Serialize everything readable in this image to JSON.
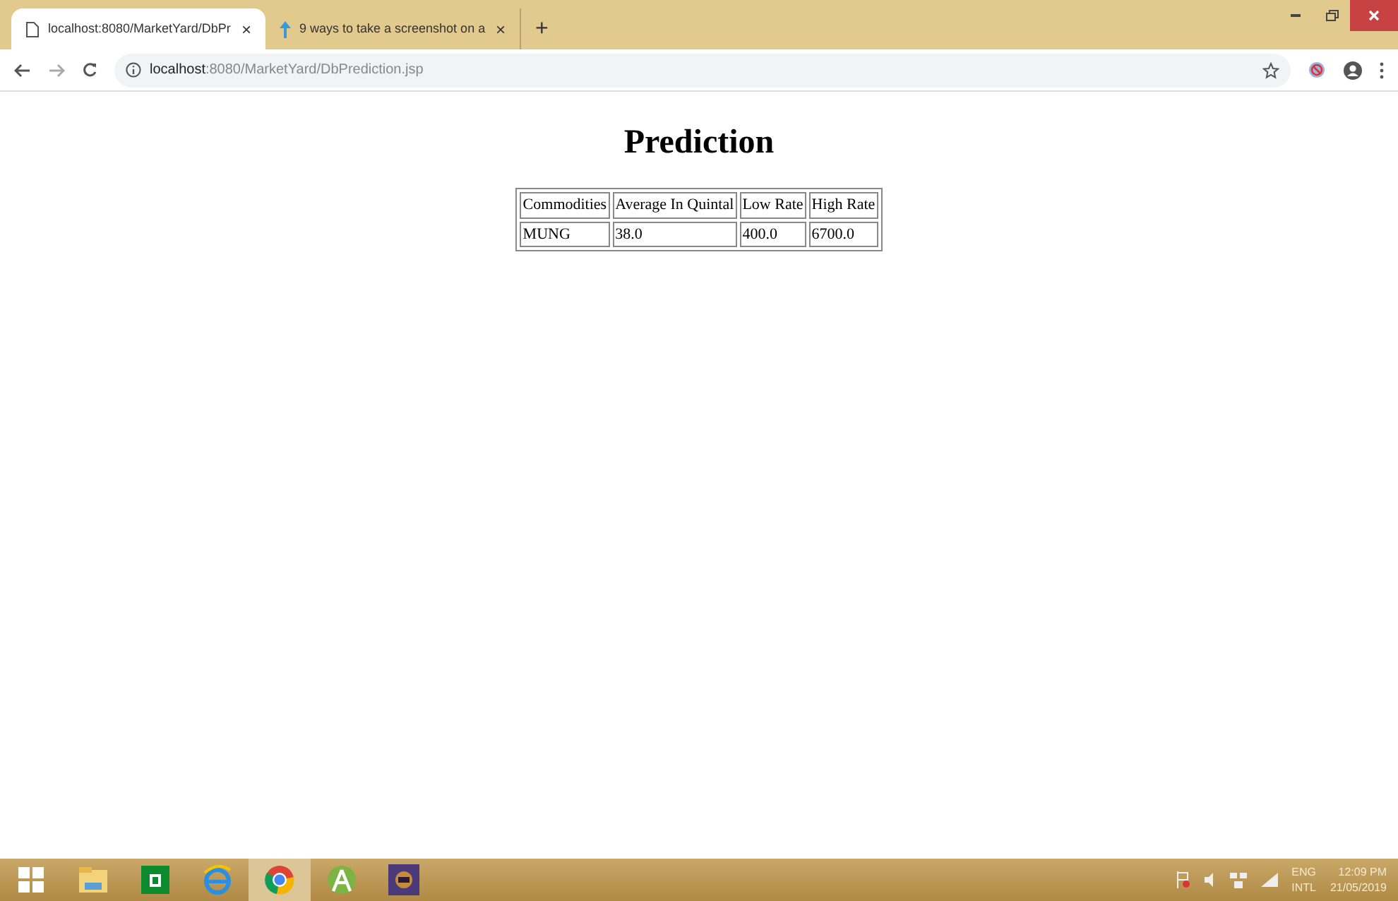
{
  "tabs": [
    {
      "title": "localhost:8080/MarketYard/DbPr",
      "selected": true,
      "close": "×"
    },
    {
      "title": "9 ways to take a screenshot on a",
      "selected": false,
      "close": "×"
    }
  ],
  "new_tab": "+",
  "address": {
    "host": "localhost",
    "path": ":8080/MarketYard/DbPrediction.jsp"
  },
  "page": {
    "heading": "Prediction",
    "table": {
      "columns": [
        "Commodities",
        "Average In Quintal",
        "Low Rate",
        "High Rate"
      ],
      "rows": [
        [
          "MUNG",
          "38.0",
          "400.0",
          "6700.0"
        ]
      ]
    }
  },
  "taskbar": {
    "apps": [
      {
        "kind": "files",
        "selected": false
      },
      {
        "kind": "store",
        "selected": false
      },
      {
        "kind": "ie",
        "selected": false
      },
      {
        "kind": "chrome",
        "selected": true
      },
      {
        "kind": "android",
        "selected": false
      },
      {
        "kind": "app",
        "selected": false
      }
    ],
    "language": "ENG",
    "layout": "INTL",
    "time": "12:09 PM",
    "date": "21/05/2019"
  }
}
